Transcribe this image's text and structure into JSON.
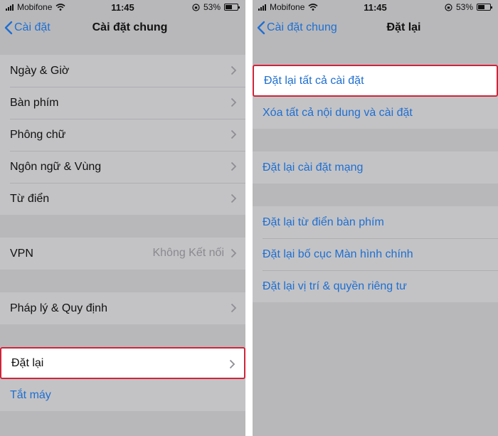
{
  "left_screen": {
    "status": {
      "carrier": "Mobifone",
      "time": "11:45",
      "battery": "53%",
      "battery_level": 0.53
    },
    "nav": {
      "back_label": "Cài đặt",
      "title": "Cài đặt chung"
    },
    "group1": [
      {
        "label": "Ngày & Giờ"
      },
      {
        "label": "Bàn phím"
      },
      {
        "label": "Phông chữ"
      },
      {
        "label": "Ngôn ngữ & Vùng"
      },
      {
        "label": "Từ điển"
      }
    ],
    "vpn": {
      "label": "VPN",
      "detail": "Không Kết nối"
    },
    "legal": {
      "label": "Pháp lý & Quy định"
    },
    "reset": {
      "label": "Đặt lại"
    },
    "shutdown": {
      "label": "Tắt máy"
    }
  },
  "right_screen": {
    "status": {
      "carrier": "Mobifone",
      "time": "11:45",
      "battery": "53%",
      "battery_level": 0.53
    },
    "nav": {
      "back_label": "Cài đặt chung",
      "title": "Đặt lại"
    },
    "group1": [
      {
        "label": "Đặt lại tất cả cài đặt"
      },
      {
        "label": "Xóa tất cả nội dung và cài đặt"
      }
    ],
    "group2": [
      {
        "label": "Đặt lại cài đặt mạng"
      }
    ],
    "group3": [
      {
        "label": "Đặt lại từ điển bàn phím"
      },
      {
        "label": "Đặt lại bố cục Màn hình chính"
      },
      {
        "label": "Đặt lại vị trí & quyền riêng tư"
      }
    ]
  },
  "colors": {
    "accent": "#1f6fd0",
    "highlight_border": "#d0243a",
    "background": "#b8b8bb"
  }
}
